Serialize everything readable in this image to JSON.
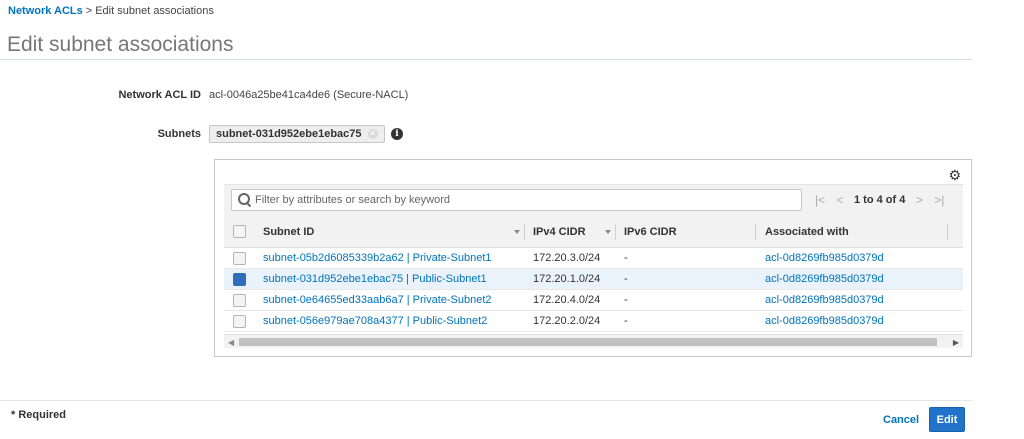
{
  "breadcrumb": {
    "parent": "Network ACLs",
    "separator": ">",
    "current": "Edit subnet associations"
  },
  "page_title": "Edit subnet associations",
  "form": {
    "acl_label": "Network ACL ID",
    "acl_value": "acl-0046a25be41ca4de6 (Secure-NACL)",
    "subnets_label": "Subnets",
    "subnet_token": "subnet-031d952ebe1ebac75",
    "info_glyph": "i"
  },
  "table": {
    "search_placeholder": "Filter by attributes or search by keyword",
    "pagination": {
      "first": "|<",
      "prev": "<",
      "text": "1 to 4 of 4",
      "next": ">",
      "last": ">|"
    },
    "columns": {
      "subnet_id": "Subnet ID",
      "ipv4": "IPv4 CIDR",
      "ipv6": "IPv6 CIDR",
      "associated": "Associated with"
    },
    "rows": [
      {
        "subnet": "subnet-05b2d6085339b2a62 | Private-Subnet1",
        "ipv4": "172.20.3.0/24",
        "ipv6": "-",
        "assoc": "acl-0d8269fb985d0379d",
        "checked": false
      },
      {
        "subnet": "subnet-031d952ebe1ebac75 | Public-Subnet1",
        "ipv4": "172.20.1.0/24",
        "ipv6": "-",
        "assoc": "acl-0d8269fb985d0379d",
        "checked": true
      },
      {
        "subnet": "subnet-0e64655ed33aab6a7 | Private-Subnet2",
        "ipv4": "172.20.4.0/24",
        "ipv6": "-",
        "assoc": "acl-0d8269fb985d0379d",
        "checked": false
      },
      {
        "subnet": "subnet-056e979ae708a4377 | Public-Subnet2",
        "ipv4": "172.20.2.0/24",
        "ipv6": "-",
        "assoc": "acl-0d8269fb985d0379d",
        "checked": false
      }
    ]
  },
  "footer": {
    "required_note": "* Required",
    "cancel_label": "Cancel",
    "edit_label": "Edit"
  },
  "colors": {
    "link": "#0073bb",
    "primary_button": "#2073c8",
    "selected_row": "#eaf3fb"
  },
  "icons": {
    "gear": "gear-icon",
    "search": "search-icon",
    "info": "info-icon",
    "remove_token": "close-icon"
  }
}
